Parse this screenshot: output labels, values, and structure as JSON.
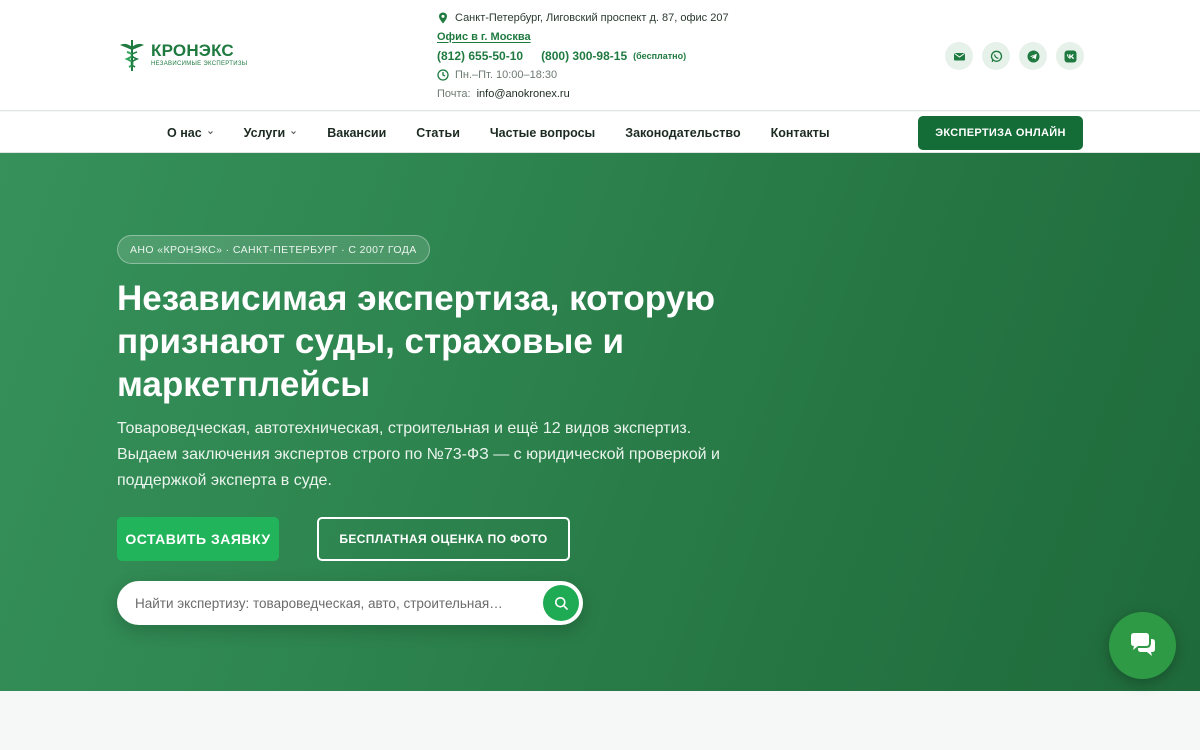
{
  "brand": {
    "name": "КРОНЭКС",
    "tagline": "независимые экспертизы",
    "color": "#1f7a40"
  },
  "contacts": {
    "address": "Санкт-Петербург, Лиговский проспект д. 87, офис 207",
    "moscow_link": "Офис в г. Москва",
    "phone_local": "(812) 655-50-10",
    "phone_free": "(800) 300-98-15",
    "phone_free_note": "(бесплатно)",
    "hours": "Пн.–Пт. 10:00–18:30",
    "email_label": "Почта:",
    "email": "info@anokronex.ru"
  },
  "socials": [
    "mail-icon",
    "whatsapp-icon",
    "telegram-icon",
    "vk-icon"
  ],
  "nav": {
    "items": [
      {
        "label": "О нас",
        "dropdown": true
      },
      {
        "label": "Услуги",
        "dropdown": true
      },
      {
        "label": "Вакансии",
        "dropdown": false
      },
      {
        "label": "Статьи",
        "dropdown": false
      },
      {
        "label": "Частые вопросы",
        "dropdown": false
      },
      {
        "label": "Законодательство",
        "dropdown": false
      },
      {
        "label": "Контакты",
        "dropdown": false
      }
    ],
    "cta": "ЭКСПЕРТИЗА ОНЛАЙН"
  },
  "hero": {
    "badge": "АНО «КРОНЭКС» · САНКТ-ПЕТЕРБУРГ · С 2007 ГОДА",
    "title": "Независимая экспертиза, которую признают суды, страховые и маркетплейсы",
    "subtitle": "Товароведческая, автотехническая, строительная и ещё 12 видов экспертиз. Выдаем заключения экспертов строго по №73-ФЗ — с юридической проверкой и поддержкой эксперта в суде.",
    "primary_button": "ОСТАВИТЬ ЗАЯВКУ",
    "secondary_button": "БЕСПЛАТНАЯ ОЦЕНКА ПО ФОТО",
    "search_placeholder": "Найти экспертизу: товароведческая, авто, строительная…"
  },
  "colors": {
    "accent": "#22b45b",
    "dark_green": "#146c37"
  }
}
